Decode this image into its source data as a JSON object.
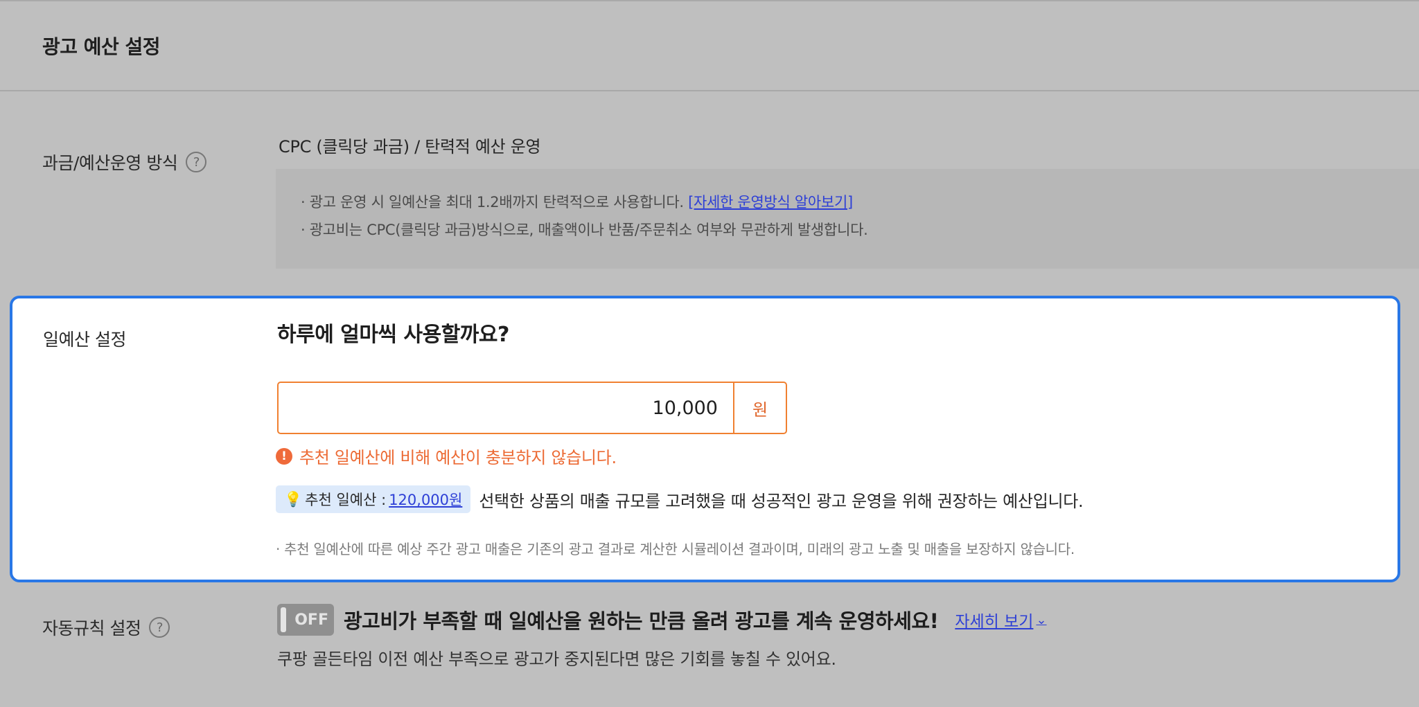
{
  "header": {
    "title": "광고 예산 설정"
  },
  "billing": {
    "label": "과금/예산운영 방식",
    "help_icon": "question-circle-icon",
    "value": "CPC (클릭당 과금) / 탄력적 예산 운영",
    "notice_line1": "· 광고 운영 시 일예산을 최대 1.2배까지 탄력적으로 사용합니다. ",
    "notice_link": "[자세한 운영방식 알아보기]",
    "notice_line2": "· 광고비는 CPC(클릭당 과금)방식으로, 매출액이나 반품/주문취소 여부와 무관하게 발생합니다."
  },
  "budget": {
    "label": "일예산 설정",
    "question": "하루에 얼마씩 사용할까요?",
    "value": "10,000",
    "unit": "원",
    "warning": "추천 일예산에 비해 예산이 충분하지 않습니다.",
    "recommend_prefix": "추천 일예산 :",
    "recommend_amount": "120,000원",
    "recommend_desc": "선택한 상품의 매출 규모를 고려했을 때 성공적인 광고 운영을 위해 권장하는 예산입니다.",
    "disclaimer": "· 추천 일예산에 따른 예상 주간 광고 매출은 기존의 광고 결과로 계산한 시뮬레이션 결과이며, 미래의 광고 노출 및 매출을 보장하지 않습니다.",
    "accent_color": "#2977e6",
    "warning_color": "#ec6a34"
  },
  "auto_rule": {
    "label": "자동규칙 설정",
    "toggle": "OFF",
    "headline": "광고비가 부족할 때 일예산을 원하는 만큼 올려 광고를 계속 운영하세요!",
    "link": "자세히 보기",
    "sub": "쿠팡 골든타임 이전 예산 부족으로 광고가 중지된다면 많은 기회를 놓칠 수 있어요."
  }
}
